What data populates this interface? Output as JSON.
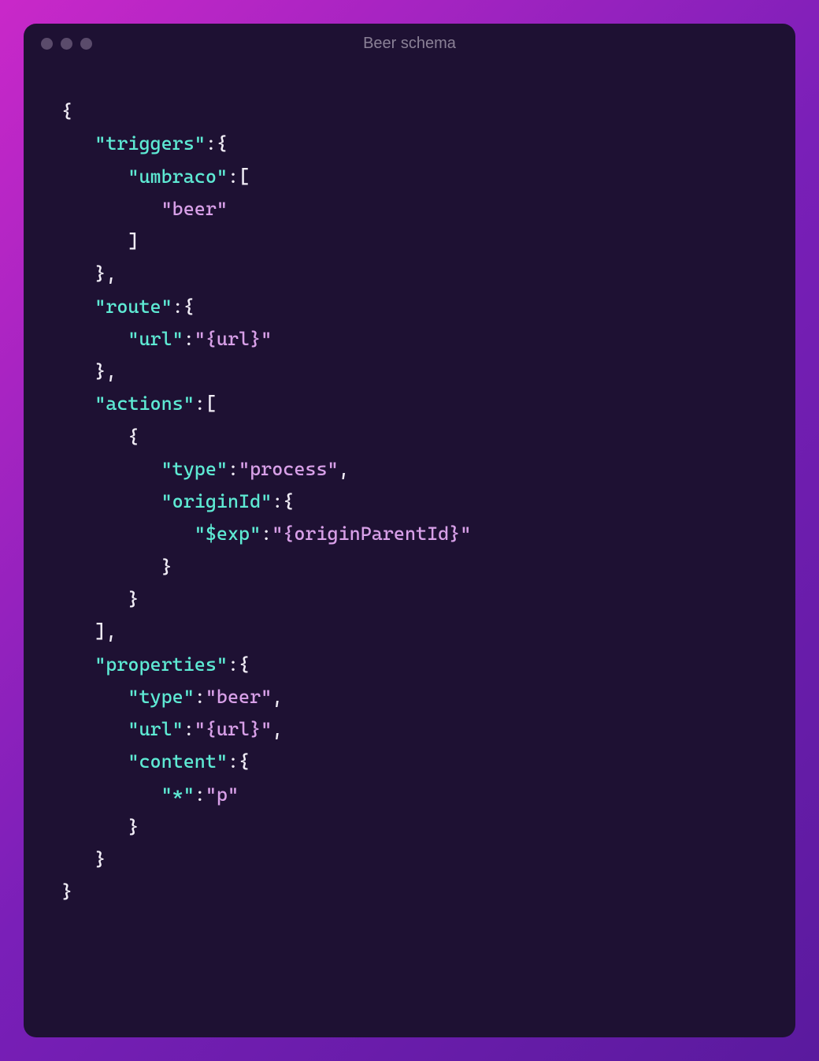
{
  "window": {
    "title": "Beer schema"
  },
  "code": {
    "tokens": [
      {
        "t": "{",
        "c": "punct"
      },
      {
        "t": "\n   ",
        "c": "punct"
      },
      {
        "t": "\"triggers\"",
        "c": "key"
      },
      {
        "t": ":{",
        "c": "punct"
      },
      {
        "t": "\n      ",
        "c": "punct"
      },
      {
        "t": "\"umbraco\"",
        "c": "key"
      },
      {
        "t": ":[",
        "c": "punct"
      },
      {
        "t": "\n         ",
        "c": "punct"
      },
      {
        "t": "\"beer\"",
        "c": "str"
      },
      {
        "t": "\n      ]",
        "c": "punct"
      },
      {
        "t": "\n   },",
        "c": "punct"
      },
      {
        "t": "\n   ",
        "c": "punct"
      },
      {
        "t": "\"route\"",
        "c": "key"
      },
      {
        "t": ":{",
        "c": "punct"
      },
      {
        "t": "\n      ",
        "c": "punct"
      },
      {
        "t": "\"url\"",
        "c": "key"
      },
      {
        "t": ":",
        "c": "punct"
      },
      {
        "t": "\"{url}\"",
        "c": "str"
      },
      {
        "t": "\n   },",
        "c": "punct"
      },
      {
        "t": "\n   ",
        "c": "punct"
      },
      {
        "t": "\"actions\"",
        "c": "key"
      },
      {
        "t": ":[",
        "c": "punct"
      },
      {
        "t": "\n      {",
        "c": "punct"
      },
      {
        "t": "\n         ",
        "c": "punct"
      },
      {
        "t": "\"type\"",
        "c": "key"
      },
      {
        "t": ":",
        "c": "punct"
      },
      {
        "t": "\"process\"",
        "c": "str"
      },
      {
        "t": ",",
        "c": "punct"
      },
      {
        "t": "\n         ",
        "c": "punct"
      },
      {
        "t": "\"originId\"",
        "c": "key"
      },
      {
        "t": ":{",
        "c": "punct"
      },
      {
        "t": "\n            ",
        "c": "punct"
      },
      {
        "t": "\"$exp\"",
        "c": "key"
      },
      {
        "t": ":",
        "c": "punct"
      },
      {
        "t": "\"{originParentId}\"",
        "c": "str"
      },
      {
        "t": "\n         }",
        "c": "punct"
      },
      {
        "t": "\n      }",
        "c": "punct"
      },
      {
        "t": "\n   ],",
        "c": "punct"
      },
      {
        "t": "\n   ",
        "c": "punct"
      },
      {
        "t": "\"properties\"",
        "c": "key"
      },
      {
        "t": ":{",
        "c": "punct"
      },
      {
        "t": "\n      ",
        "c": "punct"
      },
      {
        "t": "\"type\"",
        "c": "key"
      },
      {
        "t": ":",
        "c": "punct"
      },
      {
        "t": "\"beer\"",
        "c": "str"
      },
      {
        "t": ",",
        "c": "punct"
      },
      {
        "t": "\n      ",
        "c": "punct"
      },
      {
        "t": "\"url\"",
        "c": "key"
      },
      {
        "t": ":",
        "c": "punct"
      },
      {
        "t": "\"{url}\"",
        "c": "str"
      },
      {
        "t": ",",
        "c": "punct"
      },
      {
        "t": "\n      ",
        "c": "punct"
      },
      {
        "t": "\"content\"",
        "c": "key"
      },
      {
        "t": ":{",
        "c": "punct"
      },
      {
        "t": "\n         ",
        "c": "punct"
      },
      {
        "t": "\"*\"",
        "c": "key"
      },
      {
        "t": ":",
        "c": "punct"
      },
      {
        "t": "\"p\"",
        "c": "str"
      },
      {
        "t": "\n      }",
        "c": "punct"
      },
      {
        "t": "\n   }",
        "c": "punct"
      },
      {
        "t": "\n}",
        "c": "punct"
      }
    ]
  }
}
